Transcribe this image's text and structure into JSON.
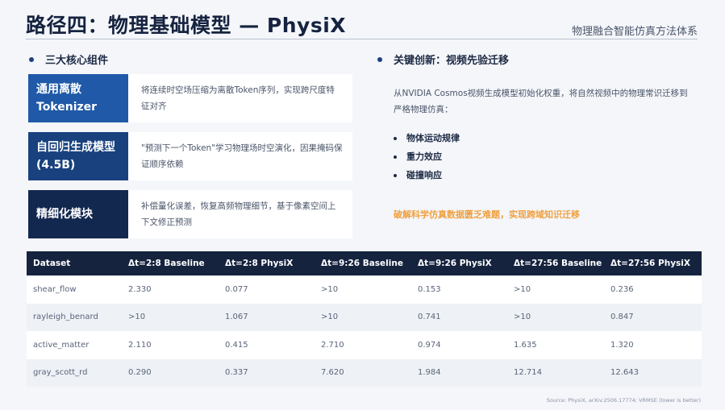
{
  "header": {
    "title": "路径四：物理基础模型 — PhysiX",
    "subtitle": "物理融合智能仿真方法体系"
  },
  "left_section": {
    "heading": "三大核心组件",
    "components": [
      {
        "label_line1": "通用离散",
        "label_line2": "Tokenizer",
        "description": "将连续时空场压缩为离散Token序列，实现跨尺度特征对齐"
      },
      {
        "label_line1": "自回归生成模型",
        "label_line2": "(4.5B)",
        "description": "\"预测下一个Token\"学习物理场时空演化，因果掩码保证顺序依赖"
      },
      {
        "label_line1": "精细化模块",
        "label_line2": "",
        "description": "补偿量化误差，恢复高频物理细节，基于像素空间上下文修正预测"
      }
    ]
  },
  "right_section": {
    "heading": "关键创新：视频先验迁移",
    "intro": "从NVIDIA Cosmos视频生成模型初始化权重，将自然视频中的物理常识迁移到严格物理仿真：",
    "bullets": [
      "物体运动规律",
      "重力效应",
      "碰撞响应"
    ],
    "highlight": "破解科学仿真数据匮乏难题，实现跨域知识迁移"
  },
  "table": {
    "headers": [
      "Dataset",
      "Δt=2:8 Baseline",
      "Δt=2:8 PhysiX",
      "Δt=9:26 Baseline",
      "Δt=9:26 PhysiX",
      "Δt=27:56 Baseline",
      "Δt=27:56 PhysiX"
    ],
    "rows": [
      [
        "shear_flow",
        "2.330",
        "0.077",
        ">10",
        "0.153",
        ">10",
        "0.236"
      ],
      [
        "rayleigh_benard",
        ">10",
        "1.067",
        ">10",
        "0.741",
        ">10",
        "0.847"
      ],
      [
        "active_matter",
        "2.110",
        "0.415",
        "2.710",
        "0.974",
        "1.635",
        "1.320"
      ],
      [
        "gray_scott_rd",
        "0.290",
        "0.337",
        "7.620",
        "1.984",
        "12.714",
        "12.643"
      ]
    ]
  },
  "source": "Source: PhysiX, arXiv:2506.17774; VRMSE (lower is better)",
  "colors": {
    "navy": "#15233f",
    "blue_1": "#1f59a8",
    "blue_2": "#18417e",
    "blue_3": "#13284f",
    "accent_orange": "#f0a040"
  }
}
